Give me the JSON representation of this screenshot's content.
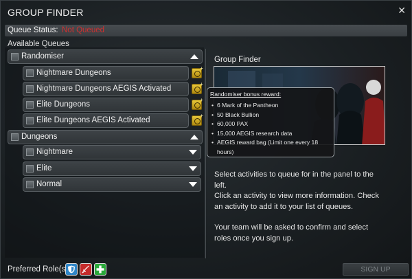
{
  "window": {
    "title": "GROUP FINDER",
    "close_label": "✕"
  },
  "status": {
    "label": "Queue Status:",
    "value": "Not Queued",
    "value_color": "#d03030"
  },
  "queues": {
    "heading": "Available Queues",
    "groups": [
      {
        "label": "Randomiser",
        "expanded": true,
        "items": [
          {
            "label": "Nightmare Dungeons",
            "bonus": true
          },
          {
            "label": "Nightmare Dungeons AEGIS Activated",
            "bonus": true
          },
          {
            "label": "Elite Dungeons",
            "bonus": true
          },
          {
            "label": "Elite Dungeons AEGIS Activated",
            "bonus": true
          }
        ]
      },
      {
        "label": "Dungeons",
        "expanded": true,
        "items": [
          {
            "label": "Nightmare",
            "bonus": false,
            "expandable": true
          },
          {
            "label": "Elite",
            "bonus": false,
            "expandable": true
          },
          {
            "label": "Normal",
            "bonus": false,
            "expandable": true
          }
        ]
      }
    ]
  },
  "info_panel": {
    "title": "Group Finder",
    "paragraphs": [
      "Select activities to queue for in the panel to the left.",
      "Click an activity to view more information. Check an activity to add it to your list of queues.",
      "Your team will be asked to confirm and select roles once you sign up."
    ]
  },
  "tooltip": {
    "heading": "Randomiser bonus reward:",
    "items": [
      "6 Mark of the Pantheon",
      "50 Black Bullion",
      "60,000 PAX",
      "15,000 AEGIS research data",
      "AEGIS reward bag (Limit one every 18 hours)"
    ]
  },
  "footer": {
    "roles_label": "Preferred Role(s):",
    "roles": [
      {
        "name": "tank",
        "icon": "shield-icon",
        "color": "#2f86c8"
      },
      {
        "name": "dps",
        "icon": "sword-icon",
        "color": "#c42a2a"
      },
      {
        "name": "healer",
        "icon": "plus-icon",
        "color": "#2aa83a"
      }
    ],
    "signup_label": "SIGN UP",
    "signup_enabled": false
  },
  "colors": {
    "accent_bonus": "#e8c83a",
    "panel_border": "#5a6064"
  }
}
